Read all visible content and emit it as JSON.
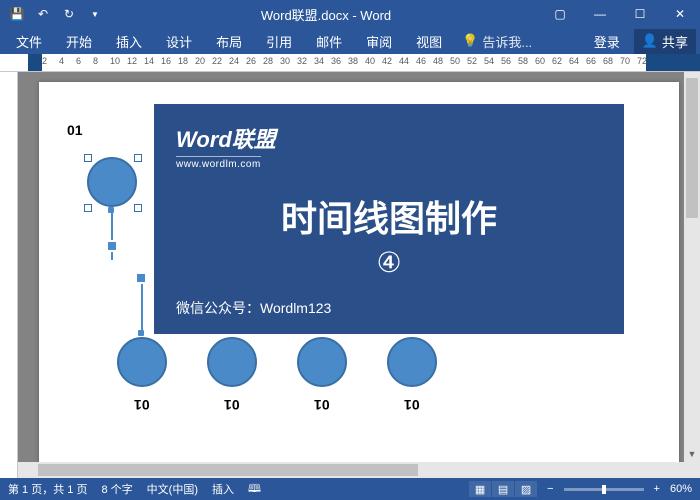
{
  "titlebar": {
    "doc_title": "Word联盟.docx - Word"
  },
  "ribbon": {
    "tabs": [
      "文件",
      "开始",
      "插入",
      "设计",
      "布局",
      "引用",
      "邮件",
      "审阅",
      "视图"
    ],
    "tell_me": "告诉我...",
    "login": "登录",
    "share": "共享"
  },
  "ruler_h": {
    "ticks": [
      2,
      4,
      6,
      8,
      10,
      12,
      14,
      16,
      18,
      20,
      22,
      24,
      26,
      28,
      30,
      32,
      34,
      36,
      38,
      40,
      42,
      44,
      46,
      48,
      50,
      52,
      54,
      56,
      58,
      60,
      62,
      64,
      66,
      68,
      70,
      72
    ]
  },
  "document": {
    "labels": {
      "top": "01",
      "b1": "01",
      "b2": "01",
      "b3": "01",
      "b4": "01"
    }
  },
  "overlay": {
    "logo_main": "Word联盟",
    "logo_url": "www.wordlm.com",
    "title": "时间线图制作",
    "subtitle": "④",
    "footer_label": "微信公众号：",
    "footer_value": "Wordlm123"
  },
  "status": {
    "page": "第 1 页，共 1 页",
    "words": "8 个字",
    "lang": "中文(中国)",
    "insert": "插入",
    "zoom": "60%"
  }
}
